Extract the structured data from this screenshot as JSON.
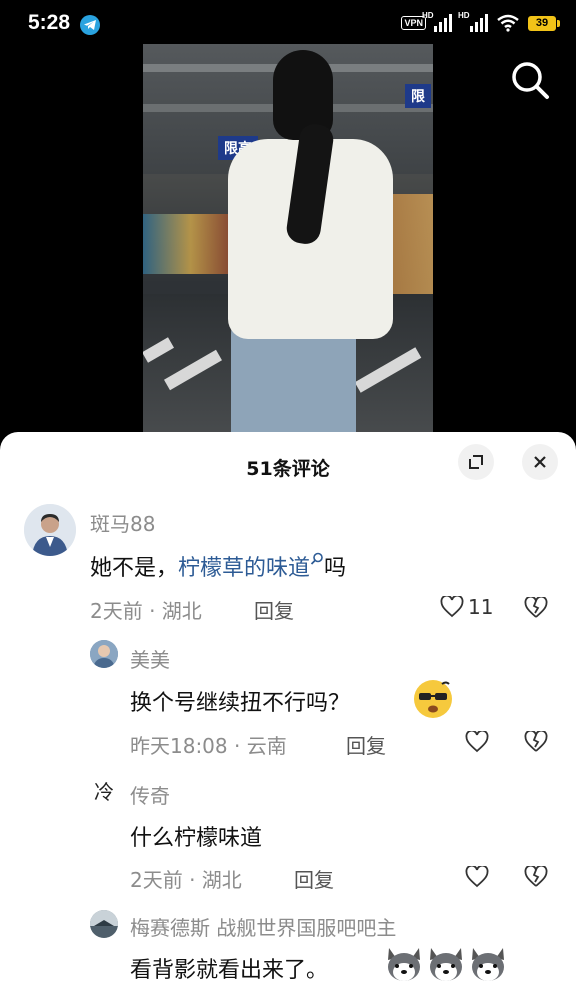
{
  "status_bar": {
    "time": "5:28",
    "vpn": "VPN",
    "hd1": "HD",
    "hd2": "HD",
    "battery": "39"
  },
  "video": {
    "sign_left": "限高",
    "sign_right": "限"
  },
  "comments_panel": {
    "title": "51条评论",
    "comments": [
      {
        "user": "斑马88",
        "text_prefix": "她不是，",
        "text_link": "柠檬草的味道",
        "text_suffix": "吗",
        "time_location": "2天前 · 湖北",
        "reply": "回复",
        "likes": "11"
      },
      {
        "user": "美美",
        "text": "换个号继续扭不行吗？",
        "time_location": "昨天18:08 · 云南",
        "reply": "回复"
      },
      {
        "user": "传奇",
        "avatar_char": "冷",
        "text": "什么柠檬味道",
        "time_location": "2天前 · 湖北",
        "reply": "回复"
      },
      {
        "user": "梅赛德斯 战舰世界国服吧吧主",
        "text": "看背影就看出来了。"
      }
    ]
  },
  "colors": {
    "link": "#2d5b95",
    "meta_text": "#8c8c8c",
    "battery": "#f2c318"
  }
}
